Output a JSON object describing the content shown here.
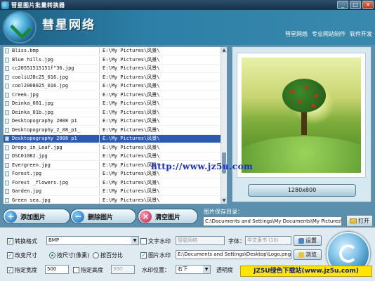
{
  "window": {
    "title": "彗星图片批量转换器",
    "controls": [
      "_",
      "□",
      "×"
    ]
  },
  "banner": {
    "brand": "彗星网络",
    "links": [
      "彗星网络",
      "专业网站制作",
      "软件开发"
    ]
  },
  "file_list": {
    "rows": [
      {
        "name": "Bliss.bmp",
        "path": "E:\\My Pictures\\风景\\"
      },
      {
        "name": "Blue hills.jpg",
        "path": "E:\\My Pictures\\风景\\"
      },
      {
        "name": "cc20551515151f\"36.jpg",
        "path": "E:\\My Pictures\\风景\\"
      },
      {
        "name": "cooliUJ8c25_016.jpg",
        "path": "E:\\My Pictures\\风景\\"
      },
      {
        "name": "cool2008025_016.jpg",
        "path": "E:\\My Pictures\\风景\\"
      },
      {
        "name": "Creek.jpg",
        "path": "E:\\My Pictures\\风景\\"
      },
      {
        "name": "Deinka_001.jpg",
        "path": "E:\\My Pictures\\风景\\"
      },
      {
        "name": "Deinka_01b.jpg",
        "path": "E:\\My Pictures\\风景\\"
      },
      {
        "name": "Desktopography 2008 p1",
        "path": "E:\\My Pictures\\风景\\"
      },
      {
        "name": "Desktopography_2_08_p1_",
        "path": "E:\\My Pictures\\风景\\"
      },
      {
        "name": "Desktopography 2008 p1",
        "path": "E:\\My Pictures\\风景\\"
      },
      {
        "name": "Drops_in_Leaf.jpg",
        "path": "E:\\My Pictures\\风景\\"
      },
      {
        "name": "DSC01082.jpg",
        "path": "E:\\My Pictures\\风景\\"
      },
      {
        "name": "Evergreen.jpg",
        "path": "E:\\My Pictures\\风景\\"
      },
      {
        "name": "Forest.jpg",
        "path": "E:\\My Pictures\\风景\\"
      },
      {
        "name": "Forest _flowers.jpg",
        "path": "E:\\My Pictures\\风景\\"
      },
      {
        "name": "Garden.jpg",
        "path": "E:\\My Pictures\\风景\\"
      },
      {
        "name": "Green sea.jpg",
        "path": "E:\\My Pictures\\风景\\"
      }
    ],
    "selected_index": 10
  },
  "preview": {
    "size_label": "1280x800"
  },
  "site_watermark": "http://www.jz5u.com",
  "actions": {
    "add_label": "添加图片",
    "remove_label": "删除图片",
    "clear_label": "清空图片"
  },
  "output": {
    "label": "图片保存目录：",
    "path": "C:\\Documents and Settings\\My Documents\\My Pictures\\",
    "open_label": "打开"
  },
  "settings": {
    "convert_format": {
      "label": "转换格式",
      "checked": true,
      "value": "BMP"
    },
    "resize": {
      "label": "改变尺寸",
      "checked": true,
      "options": [
        {
          "label": "按尺寸(像素)",
          "selected": true
        },
        {
          "label": "按百分比",
          "selected": false
        }
      ]
    },
    "width": {
      "label": "指定宽度",
      "checked": true,
      "value": "500"
    },
    "height": {
      "label": "指定高度",
      "checked": false,
      "value": "350"
    },
    "text_watermark": {
      "label": "文字水印",
      "checked": false,
      "value": "彗星网络"
    },
    "font": {
      "label": "字体：",
      "value": "华文隶书 (10)",
      "button_label": "设置"
    },
    "image_watermark": {
      "label": "图片水印",
      "checked": true,
      "value": "E:\\Documents and Settings\\Desktop\\Logo.png",
      "browse_label": "浏览"
    },
    "watermark_position": {
      "label": "水印位置：",
      "value": "右下"
    },
    "opacity_label": "透明度"
  },
  "badge_text": "JZ5U绿色下载站(www.jz5u.com)"
}
